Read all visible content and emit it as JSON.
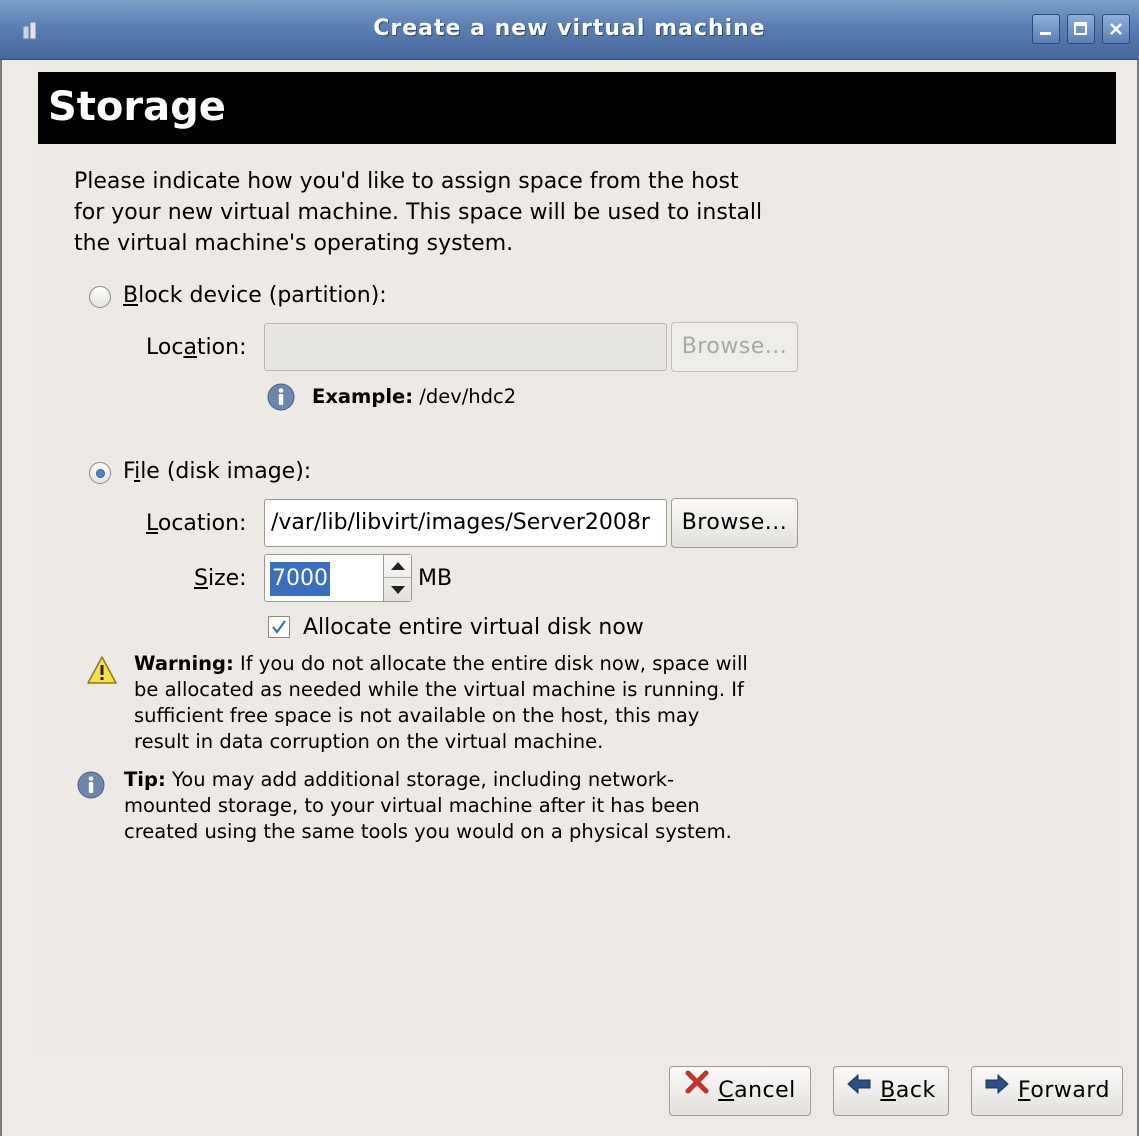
{
  "window": {
    "title": "Create a new virtual machine",
    "controls": [
      "minimize",
      "maximize",
      "close"
    ]
  },
  "header": {
    "title": "Storage"
  },
  "description": "Please indicate how you'd like to assign space from the host for your new virtual machine. This space will be used to install the virtual machine's operating system.",
  "block_device": {
    "label_pre": "",
    "label_mnemonic": "B",
    "label_post": "lock device (partition):",
    "selected": false,
    "location_label_pre": "Loc",
    "location_label_mnemonic": "a",
    "location_label_post": "tion:",
    "location_value": "",
    "browse_label": "Browse...",
    "enabled": false,
    "example_label": "Example:",
    "example_value": " /dev/hdc2"
  },
  "file_image": {
    "label_pre": "F",
    "label_mnemonic": "i",
    "label_post": "le (disk image):",
    "selected": true,
    "location_label_pre": "",
    "location_label_mnemonic": "L",
    "location_label_post": "ocation:",
    "location_value": "/var/lib/libvirt/images/Server2008r",
    "browse_label": "Browse...",
    "size_label_pre": "",
    "size_label_mnemonic": "S",
    "size_label_post": "ize:",
    "size_value": "7000",
    "size_unit": "MB",
    "allocate_label": "Allocate entire virtual disk now",
    "allocate_checked": true
  },
  "warning": {
    "bold": "Warning:",
    "line1": " If you do not allocate the entire disk now, space will",
    "line2": "be allocated as needed while the virtual machine is running. If",
    "line3": "sufficient free space is not available on the host, this may",
    "line4": "result in data corruption on the virtual machine."
  },
  "tip": {
    "bold": "Tip:",
    "line1": " You may add additional storage, including network-",
    "line2": "mounted storage, to your virtual machine after it has been",
    "line3": "created using the same tools you would on a physical system."
  },
  "buttons": {
    "cancel_mnemonic": "C",
    "cancel_rest": "ancel",
    "back_mnemonic": "B",
    "back_rest": "ack",
    "forward_mnemonic": "F",
    "forward_rest": "orward"
  },
  "colors": {
    "titlebar": "#5a7fb3",
    "selection": "#3a6fbf",
    "header_bg": "#000000"
  }
}
